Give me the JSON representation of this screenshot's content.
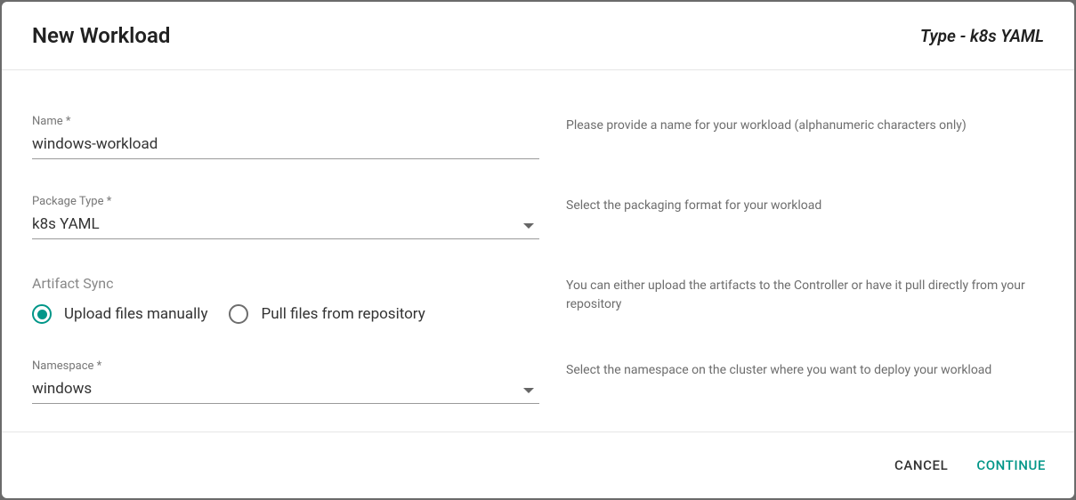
{
  "header": {
    "title": "New Workload",
    "type_prefix": "Type - ",
    "type_value": "k8s YAML"
  },
  "fields": {
    "name": {
      "label": "Name *",
      "value": "windows-workload",
      "hint": "Please provide a name for your workload (alphanumeric characters only)"
    },
    "package_type": {
      "label": "Package Type *",
      "value": "k8s YAML",
      "hint": "Select the packaging format for your workload"
    },
    "artifact_sync": {
      "label": "Artifact Sync",
      "option_upload": "Upload files manually",
      "option_pull": "Pull files from repository",
      "selected": "upload",
      "hint": "You can either upload the artifacts to the Controller or have it pull directly from your repository"
    },
    "namespace": {
      "label": "Namespace *",
      "value": "windows",
      "hint": "Select the namespace on the cluster where you want to deploy your workload"
    }
  },
  "footer": {
    "cancel": "CANCEL",
    "continue": "CONTINUE"
  }
}
